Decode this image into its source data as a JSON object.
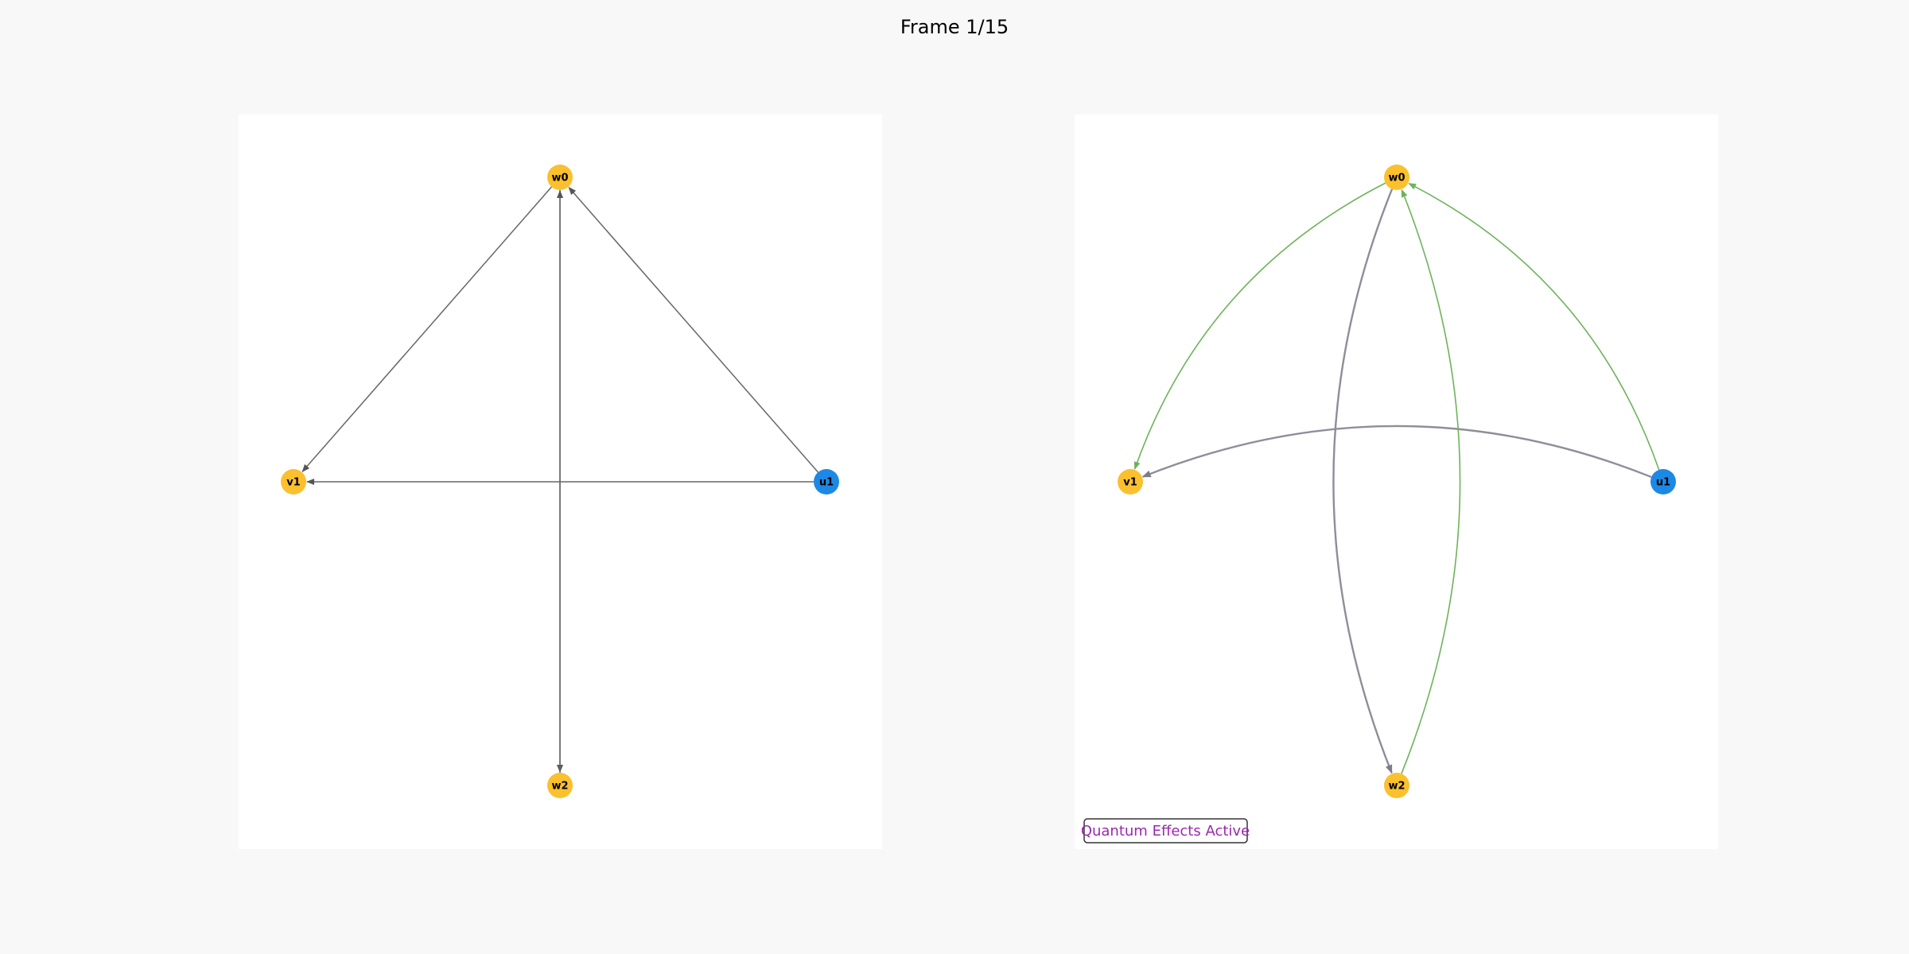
{
  "title": "Frame 1/15",
  "badge": {
    "text": "Quantum Effects Active",
    "color": "#9c27b0"
  },
  "colors": {
    "background": "#f8f8f8",
    "panel": "#ffffff",
    "node_yellow": "#fbc02d",
    "node_blue": "#1e88e5",
    "edge_gray": "#666666",
    "edge_quantum_gray": "#8e8e9a",
    "edge_green": "#6db35a"
  },
  "nodes": [
    {
      "id": "w0",
      "label": "w0",
      "color": "#fbc02d"
    },
    {
      "id": "v1",
      "label": "v1",
      "color": "#fbc02d"
    },
    {
      "id": "u1",
      "label": "u1",
      "color": "#1e88e5"
    },
    {
      "id": "w2",
      "label": "w2",
      "color": "#fbc02d"
    }
  ],
  "classical_edges": [
    {
      "from": "w0",
      "to": "v1"
    },
    {
      "from": "u1",
      "to": "w0"
    },
    {
      "from": "u1",
      "to": "v1"
    },
    {
      "from": "w0",
      "to": "w2"
    },
    {
      "from": "w2",
      "to": "w0"
    }
  ],
  "quantum_edges": [
    {
      "from": "w0",
      "to": "v1",
      "color": "#6db35a"
    },
    {
      "from": "u1",
      "to": "w0",
      "color": "#6db35a"
    },
    {
      "from": "u1",
      "to": "v1",
      "color": "#8e8e9a"
    },
    {
      "from": "w0",
      "to": "w2",
      "color": "#8e8e9a"
    },
    {
      "from": "w2",
      "to": "w0",
      "color": "#6db35a"
    }
  ]
}
